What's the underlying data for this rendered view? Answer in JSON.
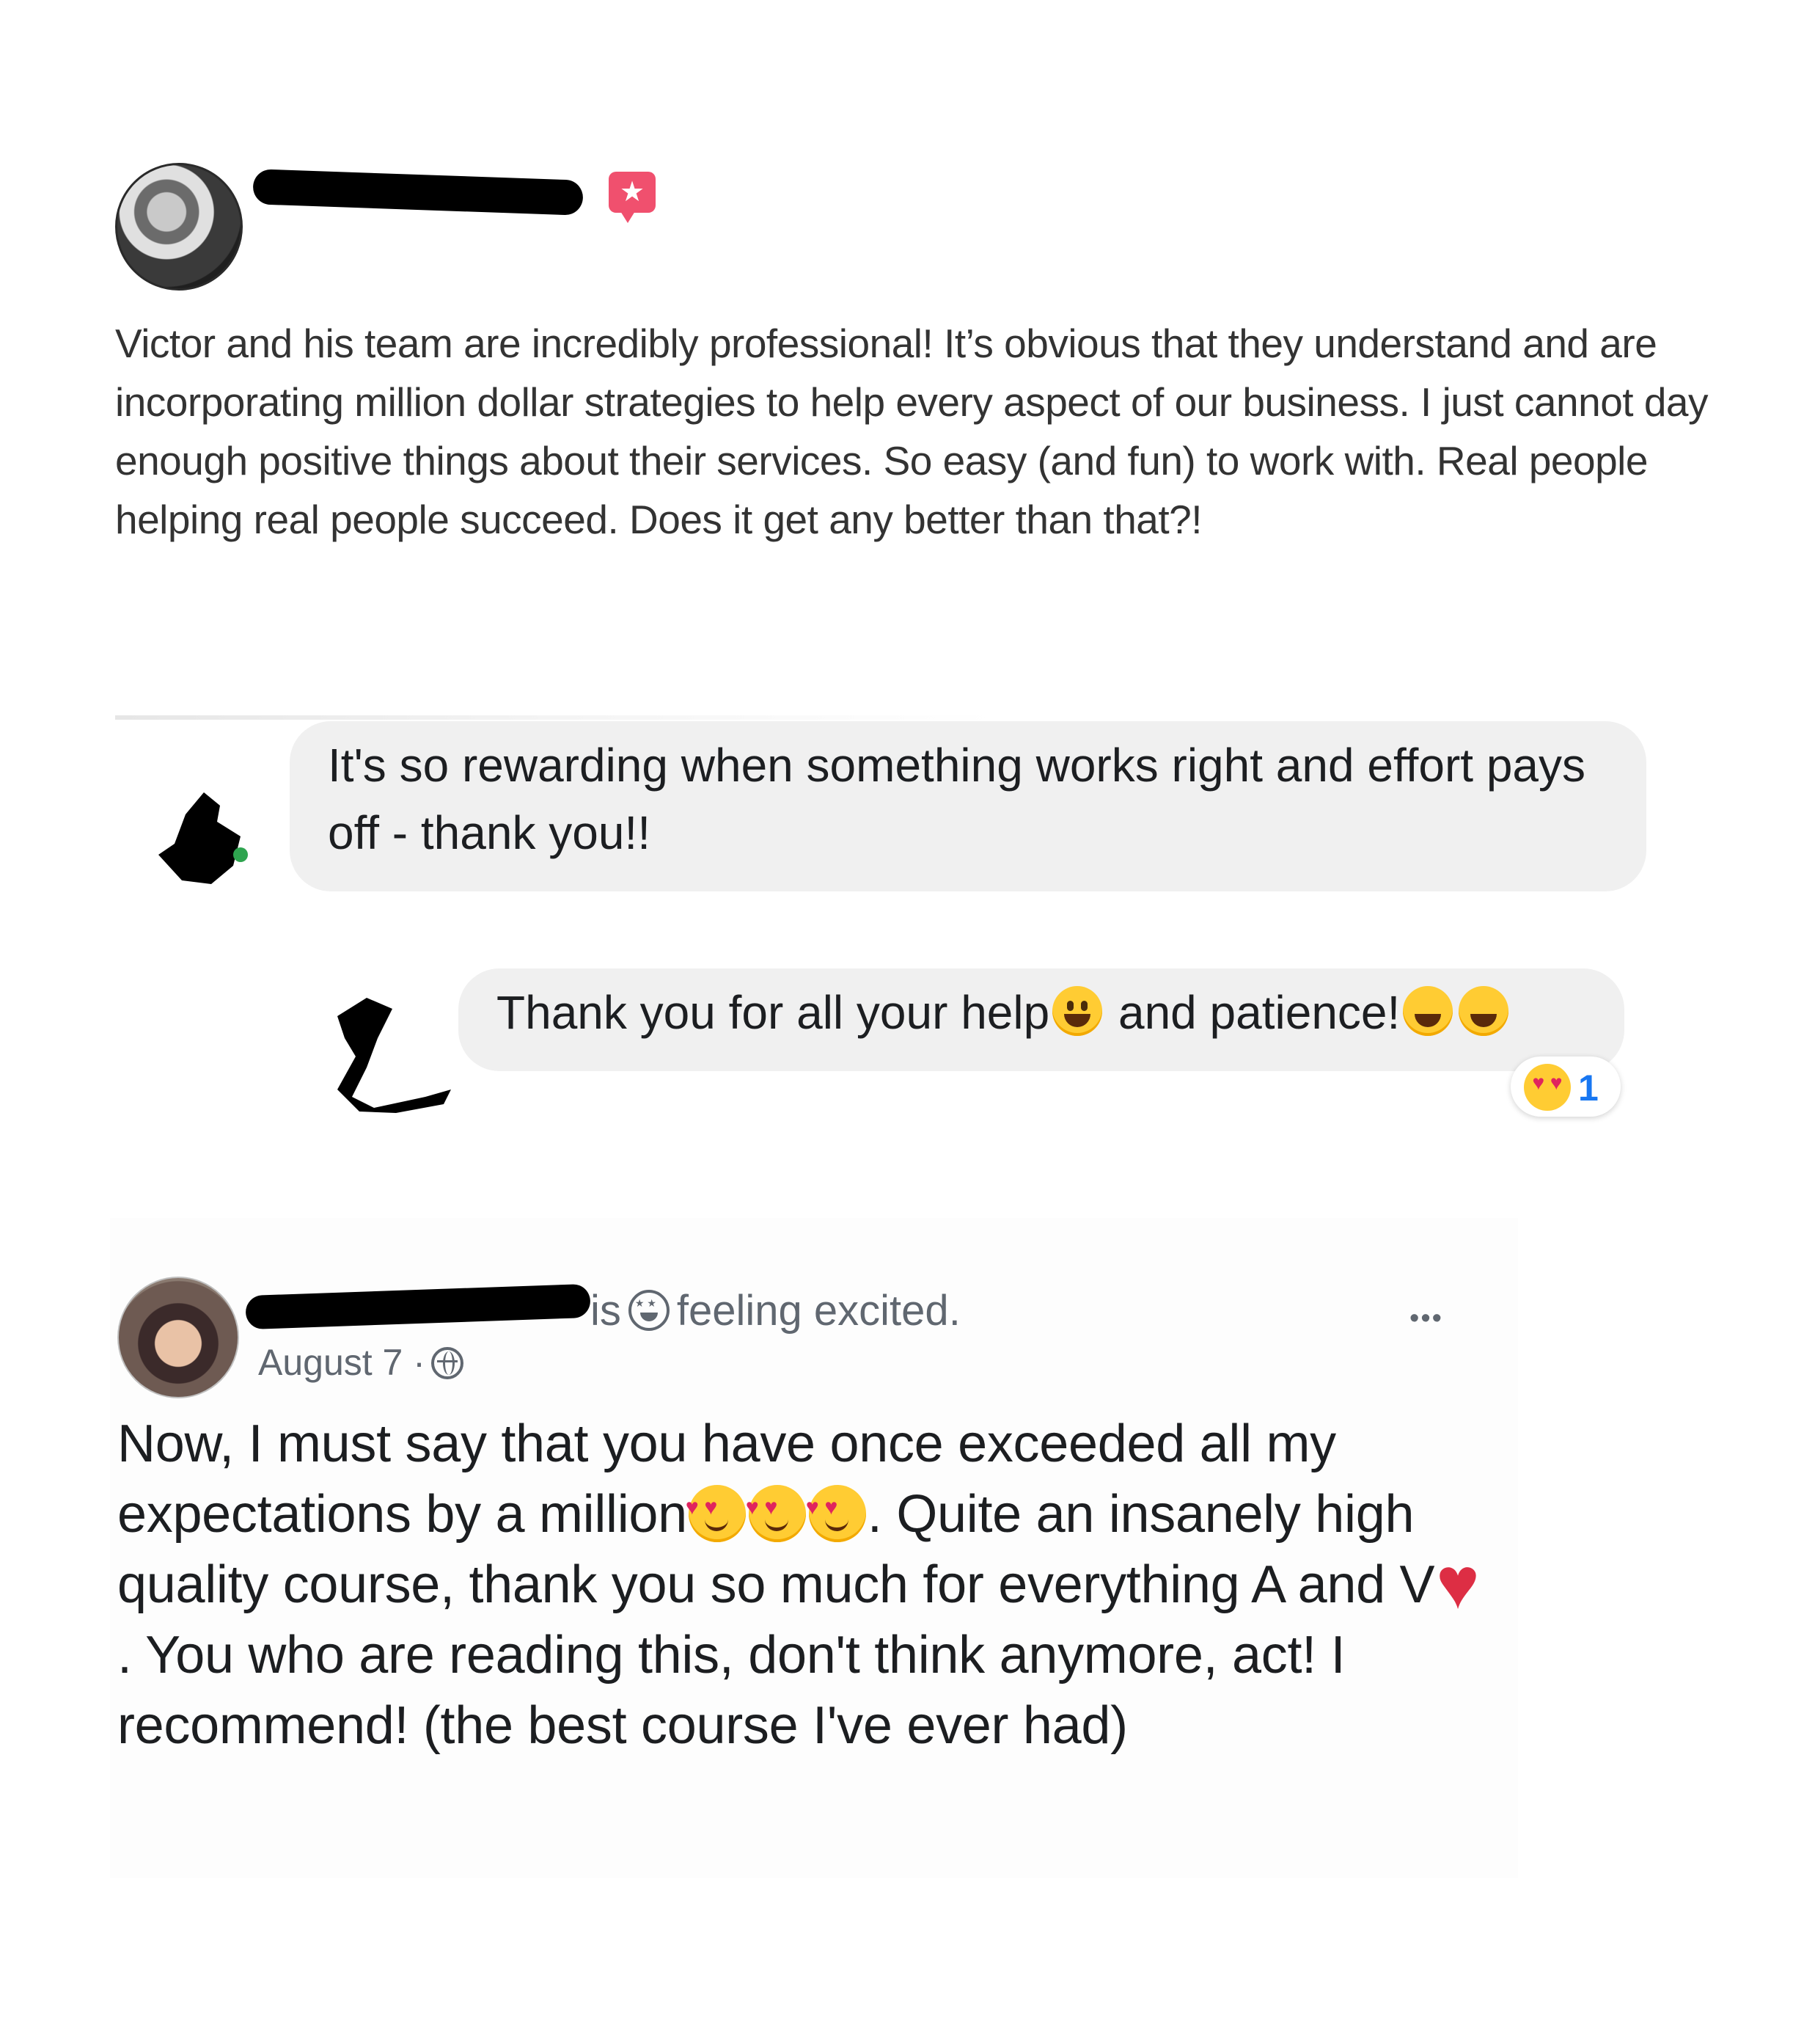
{
  "review1": {
    "text": "Victor and his team are incredibly professional! It’s obvious that they understand and are incorporating million dollar strategies to help every aspect of our business. I just cannot day enough positive things about their services. So easy (and fun) to work with. Real people helping real people succeed. Does it get any better than that?!",
    "recommend_icon": "star-recommend-icon",
    "badge_color": "#f0506e"
  },
  "chat": {
    "message1": "It's so rewarding when something works right and effort pays off - thank you!!",
    "message2_part1": "Thank you for all your help",
    "message2_part2": " and patience!",
    "reaction": {
      "icon": "heart-eyes-emoji",
      "count": "1",
      "count_color": "#1877f2"
    }
  },
  "review2": {
    "status_is": "is",
    "status_feeling": "feeling excited.",
    "date": "August 7 ·",
    "more_label": "•••",
    "text_part1": "Now, I must say that you have once exceeded all my expectations by a million",
    "text_part2": ". Quite an insanely high quality course, thank you so much for everything A and V",
    "text_part3": ". You who are reading this, don't think anymore, act! I recommend! (the best course I've ever had)"
  }
}
